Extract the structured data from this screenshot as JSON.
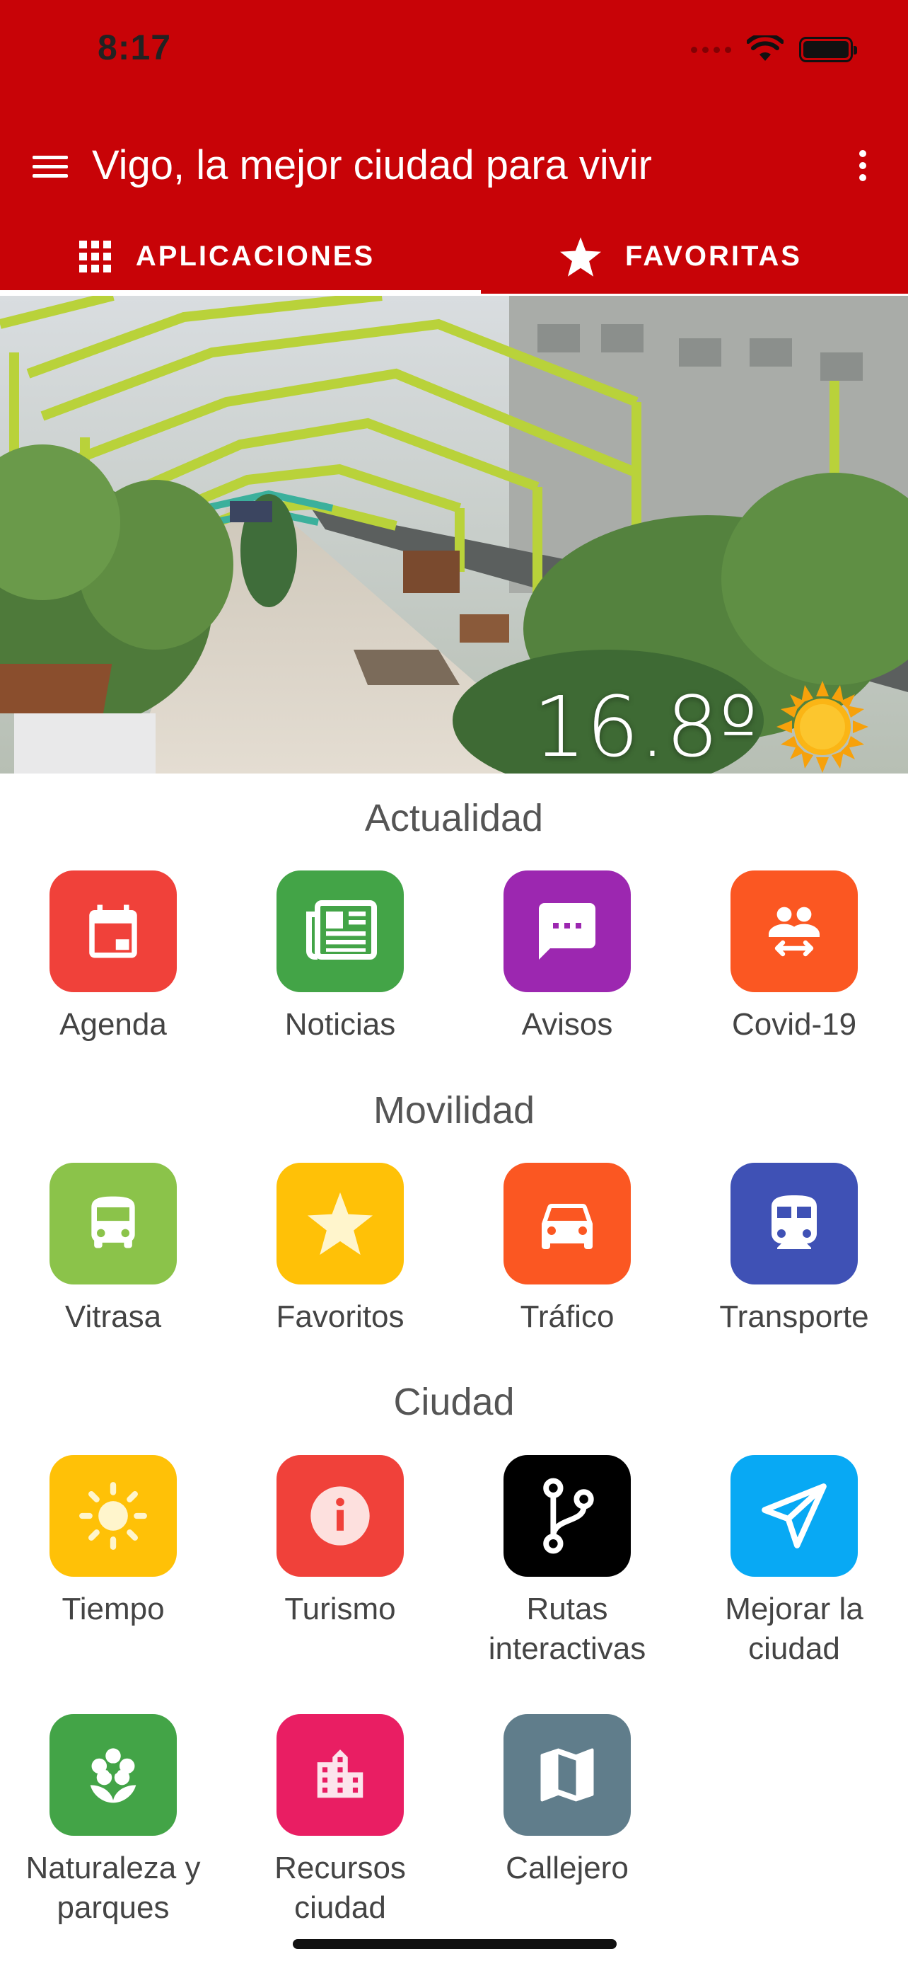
{
  "status_bar": {
    "time": "8:17"
  },
  "header": {
    "title": "Vigo, la mejor ciudad para vivir"
  },
  "tabs": [
    {
      "label": "APLICACIONES",
      "icon": "apps-grid-icon",
      "active": true
    },
    {
      "label": "FAVORITAS",
      "icon": "star-icon",
      "active": false
    }
  ],
  "weather": {
    "temperature": "16.8º",
    "icon": "sun-icon"
  },
  "sections": [
    {
      "title": "Actualidad",
      "items": [
        {
          "label": "Agenda",
          "icon": "calendar-icon",
          "color": "#f0413a"
        },
        {
          "label": "Noticias",
          "icon": "newspaper-icon",
          "color": "#43a447"
        },
        {
          "label": "Avisos",
          "icon": "message-icon",
          "color": "#9c27b0"
        },
        {
          "label": "Covid-19",
          "icon": "people-distance-icon",
          "color": "#fb5722"
        }
      ]
    },
    {
      "title": "Movilidad",
      "items": [
        {
          "label": "Vitrasa",
          "icon": "bus-icon",
          "color": "#8bc34a"
        },
        {
          "label": "Favoritos",
          "icon": "star-icon",
          "color": "#ffc107"
        },
        {
          "label": "Tráfico",
          "icon": "car-icon",
          "color": "#fb5722"
        },
        {
          "label": "Transporte",
          "icon": "train-icon",
          "color": "#3f51b5"
        }
      ]
    },
    {
      "title": "Ciudad",
      "items": [
        {
          "label": "Tiempo",
          "icon": "sun-icon",
          "color": "#ffc107"
        },
        {
          "label": "Turismo",
          "icon": "info-icon",
          "color": "#f0413a"
        },
        {
          "label": "Rutas interactivas",
          "icon": "route-fork-icon",
          "color": "#000000"
        },
        {
          "label": "Mejorar la ciudad",
          "icon": "send-plane-icon",
          "color": "#08a9f4"
        },
        {
          "label": "Naturaleza y parques",
          "icon": "flower-icon",
          "color": "#43a447"
        },
        {
          "label": "Recursos ciudad",
          "icon": "buildings-icon",
          "color": "#e91e63"
        },
        {
          "label": "Callejero",
          "icon": "map-icon",
          "color": "#607d8b"
        }
      ]
    }
  ]
}
